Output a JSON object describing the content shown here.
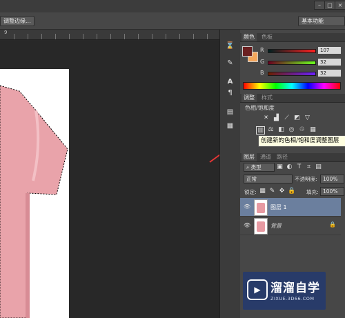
{
  "window": {
    "minimize": "–",
    "restore": "□",
    "close": "×"
  },
  "options": {
    "refine_edge": "调整边缘...",
    "workspace": "基本功能"
  },
  "ruler": {
    "label": "9"
  },
  "color_panel": {
    "tabs": [
      "颜色",
      "色板"
    ],
    "channels": [
      {
        "label": "R",
        "value": "107"
      },
      {
        "label": "G",
        "value": "32"
      },
      {
        "label": "B",
        "value": "32"
      }
    ],
    "fg_color": "#6b2020",
    "bg_color": "#f4a65b"
  },
  "adjust_panel": {
    "tabs": [
      "调整",
      "样式"
    ],
    "subtitle": "色相/饱和度",
    "tooltip": "创建新的色相/饱和度调整图层"
  },
  "layers_panel": {
    "tabs": [
      "图层",
      "通道",
      "路径"
    ],
    "filter": "类型",
    "blend_mode": "正常",
    "opacity_label": "不透明度:",
    "opacity_value": "100%",
    "lock_label": "锁定:",
    "fill_label": "填充:",
    "fill_value": "100%",
    "layers": [
      {
        "name": "图层 1",
        "selected": true
      },
      {
        "name": "背景",
        "selected": false
      }
    ]
  },
  "watermark": {
    "logo": "▶",
    "title": "溜溜自学",
    "url": "ZIXUE.3D66.COM"
  }
}
